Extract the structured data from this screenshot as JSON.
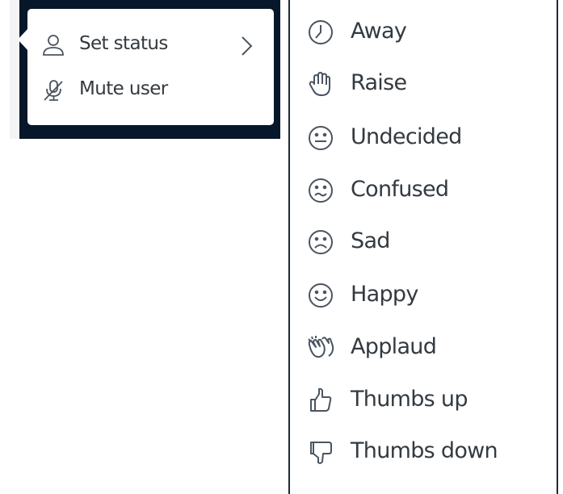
{
  "user_menu": {
    "items": [
      {
        "label": "Set status",
        "icon": "user-icon",
        "has_submenu": true
      },
      {
        "label": "Mute user",
        "icon": "mic-muted-icon"
      }
    ]
  },
  "status_menu": {
    "items": [
      {
        "label": "Away",
        "icon": "clock-icon"
      },
      {
        "label": "Raise",
        "icon": "hand-icon"
      },
      {
        "label": "Undecided",
        "icon": "neutral-face-icon"
      },
      {
        "label": "Confused",
        "icon": "confused-face-icon"
      },
      {
        "label": "Sad",
        "icon": "sad-face-icon"
      },
      {
        "label": "Happy",
        "icon": "happy-face-icon"
      },
      {
        "label": "Applaud",
        "icon": "applaud-icon"
      },
      {
        "label": "Thumbs up",
        "icon": "thumbs-up-icon"
      },
      {
        "label": "Thumbs down",
        "icon": "thumbs-down-icon"
      }
    ]
  },
  "colors": {
    "backdrop": "#06172a",
    "text": "#333a40",
    "panel_border": "#1f2933"
  }
}
